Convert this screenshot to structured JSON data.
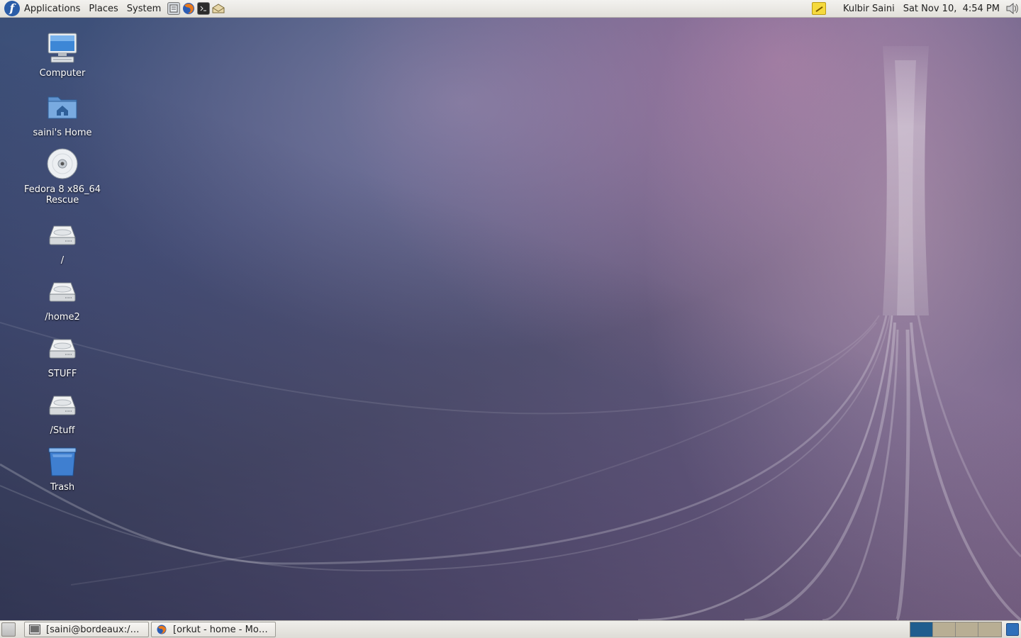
{
  "top_panel": {
    "menus": [
      "Applications",
      "Places",
      "System"
    ],
    "user": "Kulbir Saini",
    "clock": "Sat Nov 10,  4:54 PM"
  },
  "desktop_icons": [
    {
      "label": "Computer",
      "icon": "computer-icon"
    },
    {
      "label": "saini's Home",
      "icon": "home-folder-icon"
    },
    {
      "label": "Fedora 8 x86_64 Rescue",
      "icon": "cdrom-icon"
    },
    {
      "label": "/",
      "icon": "harddisk-icon"
    },
    {
      "label": "/home2",
      "icon": "harddisk-icon"
    },
    {
      "label": "STUFF",
      "icon": "harddisk-icon"
    },
    {
      "label": "/Stuff",
      "icon": "harddisk-icon"
    },
    {
      "label": "Trash",
      "icon": "trash-icon"
    }
  ],
  "taskbar": {
    "tasks": [
      {
        "label": "[saini@bordeaux:/ho…",
        "icon": "terminal-icon"
      },
      {
        "label": "[orkut - home - Mozil…",
        "icon": "firefox-icon"
      }
    ],
    "workspaces": 4,
    "active_workspace": 1
  },
  "colors": {
    "panel": "#e6e4df",
    "active_workspace": "#1f5d8e",
    "inactive_workspace": "#b8ae94"
  }
}
